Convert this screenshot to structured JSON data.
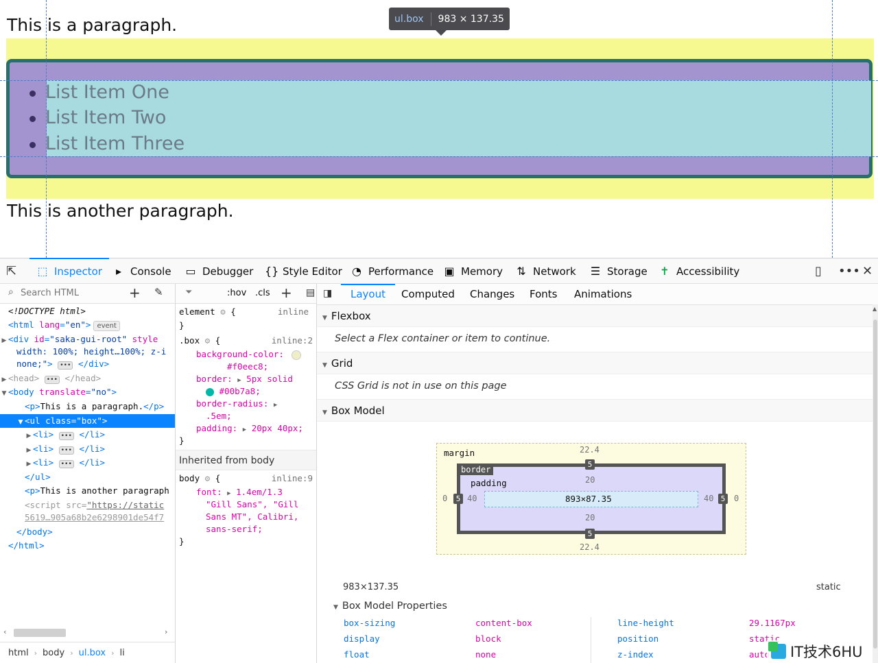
{
  "page": {
    "paragraph1": "This is a paragraph.",
    "list_items": [
      "List Item One",
      "List Item Two",
      "List Item Three"
    ],
    "paragraph2": "This is another paragraph.",
    "tooltip": {
      "tag": "ul",
      "cls": ".box",
      "size": "983 × 137.35"
    }
  },
  "toolbox": {
    "tabs": [
      {
        "label": "Inspector",
        "icon": "inspector-icon",
        "glyph": "⬚",
        "active": true
      },
      {
        "label": "Console",
        "icon": "console-icon",
        "glyph": "▶"
      },
      {
        "label": "Debugger",
        "icon": "debugger-icon",
        "glyph": "▭"
      },
      {
        "label": "Style Editor",
        "icon": "style-editor-icon",
        "glyph": "{}"
      },
      {
        "label": "Performance",
        "icon": "performance-icon",
        "glyph": "◔"
      },
      {
        "label": "Memory",
        "icon": "memory-icon",
        "glyph": "▣"
      },
      {
        "label": "Network",
        "icon": "network-icon",
        "glyph": "⇅"
      },
      {
        "label": "Storage",
        "icon": "storage-icon",
        "glyph": "☰"
      },
      {
        "label": "Accessibility",
        "icon": "accessibility-icon",
        "glyph": "✝"
      }
    ]
  },
  "markup": {
    "search_placeholder": "Search HTML",
    "breadcrumbs": [
      "html",
      "body",
      "ul.box",
      "li"
    ]
  },
  "rules": {
    "hov": ":hov",
    "cls": ".cls",
    "element_selector": "element",
    "element_source": "inline",
    "box_selector": ".box",
    "box_source": "inline:2",
    "bg_prop": "background-color:",
    "bg_val": "#f0eec8;",
    "border_prop": "border:",
    "border_val1": "5px solid",
    "border_val2": "#00b7a8;",
    "radius_prop": "border-radius:",
    "radius_val": ".5em;",
    "padding_prop": "padding:",
    "padding_val": "20px 40px;",
    "inherited_label": "Inherited from body",
    "body_selector": "body",
    "body_source": "inline:9",
    "font_prop": "font:",
    "font_val1": "1.4em/1.3",
    "font_val2": "\"Gill Sans\", \"Gill",
    "font_val3": "Sans MT\", Calibri,",
    "font_val4": "sans-serif;",
    "colors": {
      "swatch_bg": "#f0eec8",
      "swatch_border": "#00b7a8"
    }
  },
  "layout": {
    "tabs": [
      "Layout",
      "Computed",
      "Changes",
      "Fonts",
      "Animations"
    ],
    "flexbox_title": "Flexbox",
    "flexbox_msg": "Select a Flex container or item to continue.",
    "grid_title": "Grid",
    "grid_msg": "CSS Grid is not in use on this page",
    "boxmodel_title": "Box Model",
    "boxmodel": {
      "margin_label": "margin",
      "border_label": "border",
      "padding_label": "padding",
      "margin_top": "22.4",
      "margin_bottom": "22.4",
      "margin_left": "0",
      "margin_right": "0",
      "border_top": "5",
      "border_bottom": "5",
      "border_left": "5",
      "border_right": "5",
      "padding_top": "20",
      "padding_bottom": "20",
      "padding_left": "40",
      "padding_right": "40",
      "content_size": "893×87.35"
    },
    "element_size": "983×137.35",
    "position_value": "static",
    "props_title": "Box Model Properties",
    "props": [
      {
        "name": "box-sizing",
        "value": "content-box"
      },
      {
        "name": "display",
        "value": "block"
      },
      {
        "name": "float",
        "value": "none"
      },
      {
        "name": "line-height",
        "value": "29.1167px"
      },
      {
        "name": "position",
        "value": "static"
      },
      {
        "name": "z-index",
        "value": "auto"
      }
    ]
  },
  "watermark": "IT技术6HU"
}
